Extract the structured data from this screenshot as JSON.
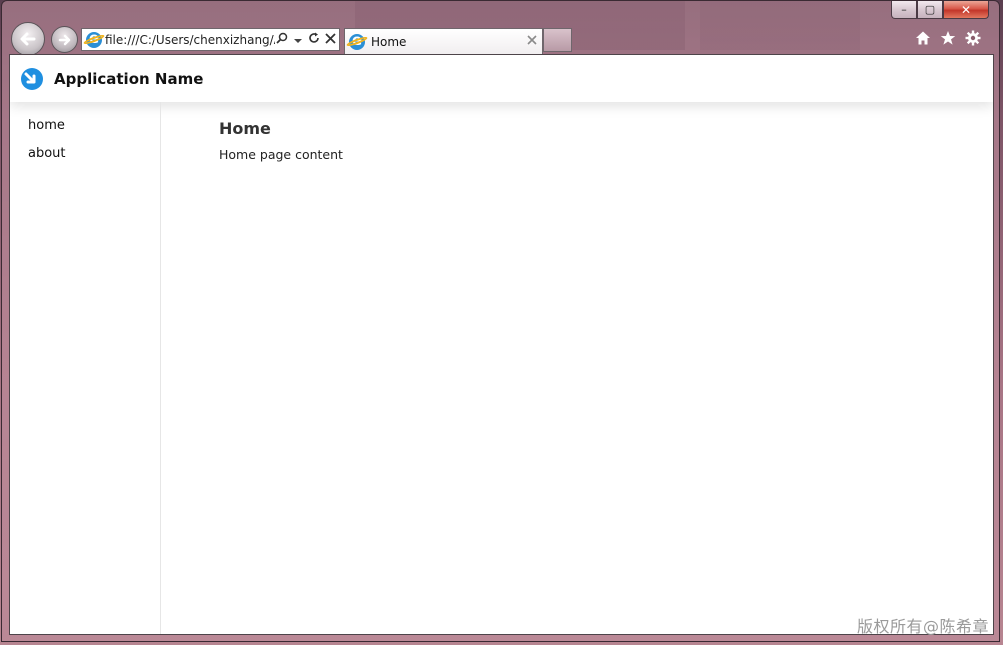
{
  "browser": {
    "address_url": "file:///C:/Users/chenxizhang/A",
    "tab_title": "Home",
    "caption": {
      "minimize": "–",
      "maximize": "▢",
      "close": "✕"
    }
  },
  "app": {
    "name": "Application Name"
  },
  "sidebar": {
    "items": [
      {
        "label": "home"
      },
      {
        "label": "about"
      }
    ]
  },
  "main": {
    "title": "Home",
    "body": "Home page content"
  },
  "watermark": "版权所有@陈希章",
  "colors": {
    "logo_blue": "#1f8fe0",
    "window_tint": "#b78591"
  },
  "icons": {
    "back": "back-arrow-icon",
    "forward": "forward-arrow-icon",
    "search": "search-icon",
    "refresh": "refresh-icon",
    "stop": "stop-icon",
    "home": "home-icon",
    "favorites": "star-icon",
    "tools": "gear-icon"
  }
}
